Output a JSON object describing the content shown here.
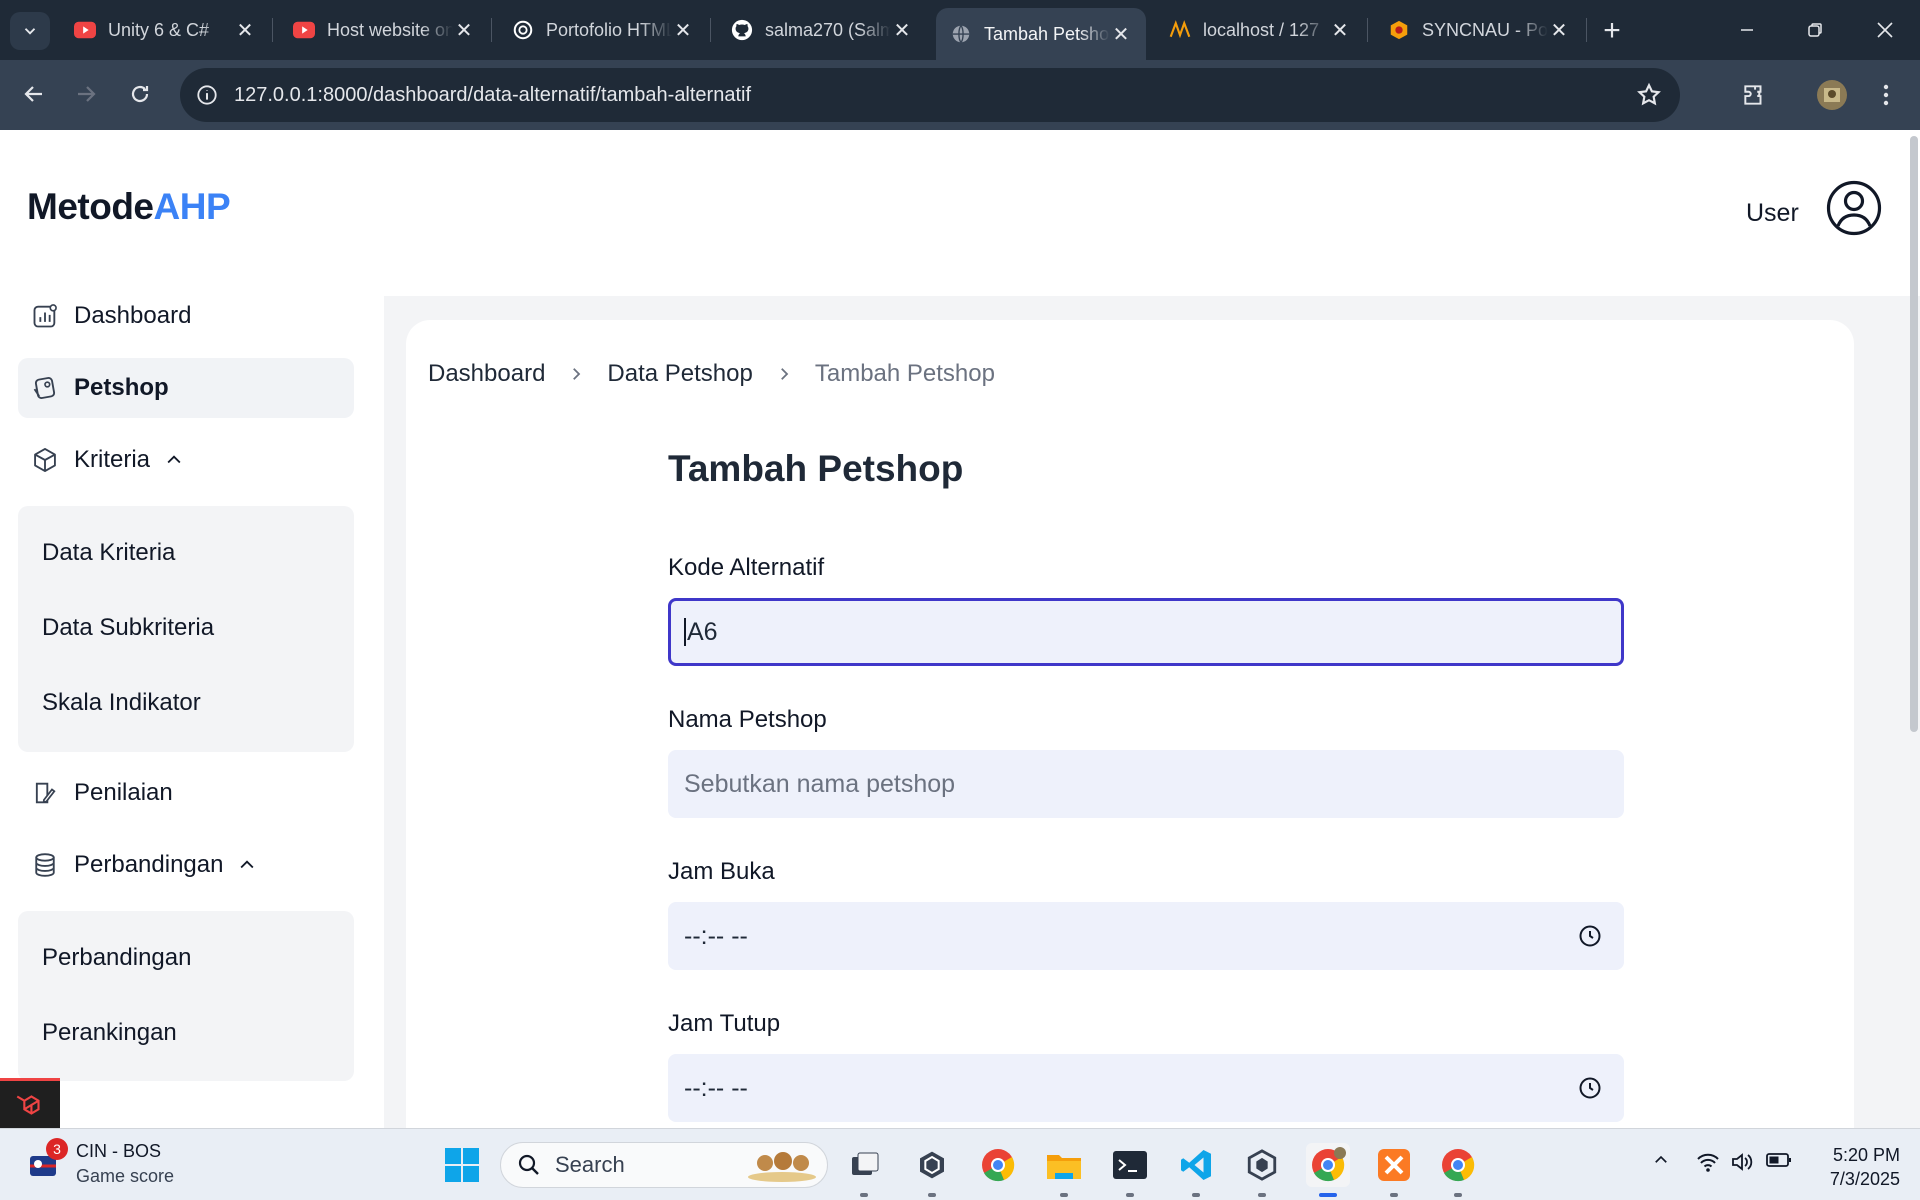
{
  "browser": {
    "tabs": [
      {
        "title": "Unity 6 & C#",
        "favicon": "youtube-icon",
        "active": false
      },
      {
        "title": "Host website on",
        "favicon": "youtube-icon",
        "active": false
      },
      {
        "title": "Portofolio HTML",
        "favicon": "openai-icon",
        "active": false
      },
      {
        "title": "salma270 (Salma",
        "favicon": "github-icon",
        "active": false
      },
      {
        "title": "Tambah Petshop",
        "favicon": "globe-icon",
        "active": true
      },
      {
        "title": "localhost / 127",
        "favicon": "phpmyadmin-icon",
        "active": false
      },
      {
        "title": "SYNCNAU - Portal",
        "favicon": "syncnau-icon",
        "active": false
      }
    ],
    "url": "127.0.0.1:8000/dashboard/data-alternatif/tambah-alternatif"
  },
  "sidebar": {
    "logo": {
      "part1": "Metode",
      "part2": "AHP"
    },
    "items": {
      "dashboard": "Dashboard",
      "petshop": "Petshop",
      "kriteria": "Kriteria",
      "penilaian": "Penilaian",
      "perbandingan": "Perbandingan"
    },
    "kriteria_sub": [
      "Data Kriteria",
      "Data Subkriteria",
      "Skala Indikator"
    ],
    "perbandingan_sub": [
      "Perbandingan",
      "Perankingan"
    ]
  },
  "header": {
    "user_label": "User"
  },
  "breadcrumb": [
    "Dashboard",
    "Data Petshop",
    "Tambah Petshop"
  ],
  "form": {
    "title": "Tambah Petshop",
    "kode": {
      "label": "Kode Alternatif",
      "value": "A6"
    },
    "nama": {
      "label": "Nama Petshop",
      "placeholder": "Sebutkan nama petshop"
    },
    "jam_buka": {
      "label": "Jam Buka",
      "value": "--:-- --"
    },
    "jam_tutup": {
      "label": "Jam Tutup",
      "value": "--:-- --"
    }
  },
  "taskbar": {
    "widget_title": "CIN - BOS",
    "widget_subtitle": "Game score",
    "widget_badge": "3",
    "search_label": "Search",
    "time": "5:20 PM",
    "date": "7/3/2025"
  },
  "colors": {
    "accent": "#3b82f6",
    "focus_border": "#3f37c9",
    "field_bg": "#eef1fb"
  }
}
